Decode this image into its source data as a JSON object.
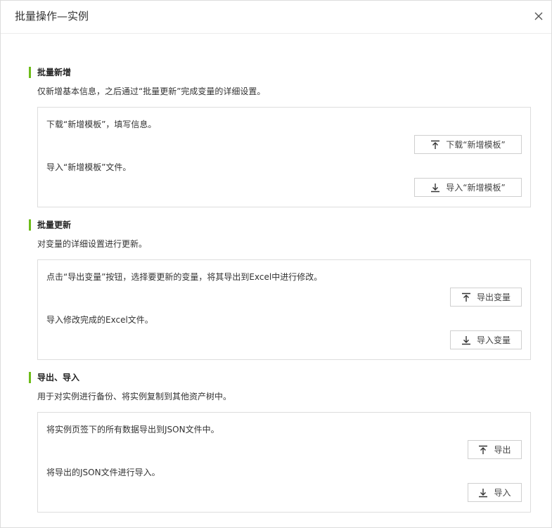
{
  "dialog": {
    "title": "批量操作—实例",
    "close_icon": "close-icon"
  },
  "sections": [
    {
      "title": "批量新增",
      "description": "仅新增基本信息，之后通过“批量更新”完成变量的详细设置。",
      "steps": [
        {
          "text": "下载“新增模板”，填写信息。",
          "button": "下载“新增模板”",
          "icon": "export-icon"
        },
        {
          "text": "导入“新增模板”文件。",
          "button": "导入“新增模板”",
          "icon": "import-icon"
        }
      ]
    },
    {
      "title": "批量更新",
      "description": "对变量的详细设置进行更新。",
      "steps": [
        {
          "text": "点击“导出变量”按钮，选择要更新的变量，将其导出到Excel中进行修改。",
          "button": "导出变量",
          "icon": "export-icon"
        },
        {
          "text": "导入修改完成的Excel文件。",
          "button": "导入变量",
          "icon": "import-icon"
        }
      ]
    },
    {
      "title": "导出、导入",
      "description": "用于对实例进行备份、将实例复制到其他资产树中。",
      "steps": [
        {
          "text": "将实例页签下的所有数据导出到JSON文件中。",
          "button": "导出",
          "icon": "export-icon"
        },
        {
          "text": "将导出的JSON文件进行导入。",
          "button": "导入",
          "icon": "import-icon"
        }
      ]
    }
  ],
  "colors": {
    "accent": "#6ebd1a",
    "border": "#dddddd",
    "text": "#333333"
  }
}
